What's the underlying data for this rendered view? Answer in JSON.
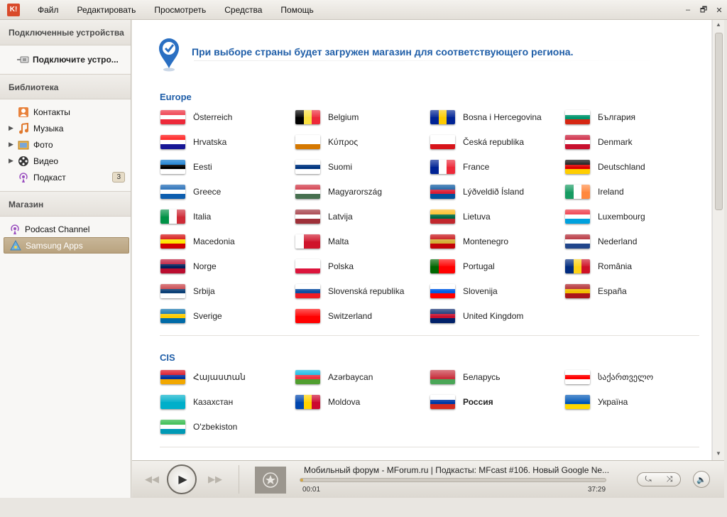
{
  "menu": {
    "logo": "K!",
    "items": [
      "Файл",
      "Редактировать",
      "Просмотреть",
      "Средства",
      "Помощь"
    ],
    "window_controls": [
      "–",
      "🗗",
      "✕"
    ]
  },
  "sidebar": {
    "devices_header": "Подключенные устройства",
    "device_label": "Подключите устро...",
    "library_header": "Библиотека",
    "library_items": [
      {
        "label": "Контакты",
        "icon": "contacts-icon",
        "expandable": false
      },
      {
        "label": "Музыка",
        "icon": "music-icon",
        "expandable": true
      },
      {
        "label": "Фото",
        "icon": "photo-icon",
        "expandable": true
      },
      {
        "label": "Видео",
        "icon": "video-icon",
        "expandable": true
      },
      {
        "label": "Подкаст",
        "icon": "podcast-icon",
        "expandable": false,
        "badge": "3"
      }
    ],
    "store_header": "Магазин",
    "store_items": [
      {
        "label": "Podcast Channel",
        "icon": "podcast-channel-icon"
      },
      {
        "label": "Samsung Apps",
        "icon": "samsung-apps-icon",
        "selected": true
      }
    ]
  },
  "main": {
    "notice": "При выборе страны будет загружен магазин для соответствующего региона.",
    "sections": [
      {
        "title": "Europe",
        "countries": [
          "Österreich",
          "Belgium",
          "Bosna i Hercegovina",
          "България",
          "Hrvatska",
          "Κύπρος",
          "Česká republika",
          "Denmark",
          "Eesti",
          "Suomi",
          "France",
          "Deutschland",
          "Greece",
          "Magyarország",
          "Lýðveldið Ísland",
          "Ireland",
          "Italia",
          "Latvija",
          "Lietuva",
          "Luxembourg",
          "Macedonia",
          "Malta",
          "Montenegro",
          "Nederland",
          "Norge",
          "Polska",
          "Portugal",
          "România",
          "Srbija",
          "Slovenská republika",
          "Slovenija",
          "España",
          "Sverige",
          "Switzerland",
          "United Kingdom"
        ]
      },
      {
        "title": "CIS",
        "countries": [
          "Հայաստան",
          "Azərbaycan",
          "Беларусь",
          "საქართველო",
          "Казахстан",
          "Moldova",
          "Россия",
          "Україна",
          "O'zbekiston"
        ]
      }
    ]
  },
  "player": {
    "track_title": "Мобильный форум - MForum.ru | Подкасты: MFcast #106. Новый Google Ne...",
    "time_current": "00:01",
    "time_total": "37:29",
    "progress": 0.01
  }
}
